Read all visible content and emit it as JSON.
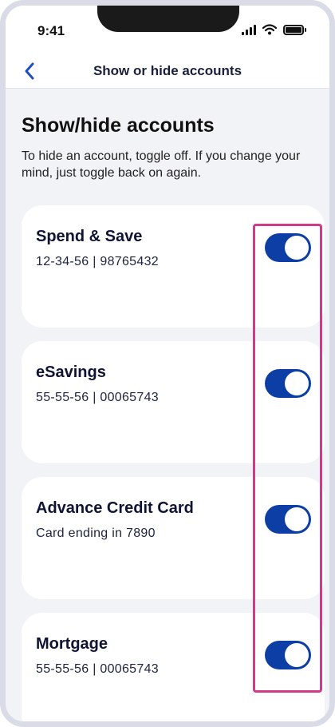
{
  "status_bar": {
    "time": "9:41"
  },
  "nav": {
    "title": "Show or hide accounts"
  },
  "page": {
    "heading": "Show/hide accounts",
    "description": "To hide an account, toggle off. If you change your mind, just toggle back on again."
  },
  "accounts": [
    {
      "name": "Spend & Save",
      "detail": "12-34-56 | 98765432",
      "visible": true
    },
    {
      "name": "eSavings",
      "detail": "55-55-56 | 00065743",
      "visible": true
    },
    {
      "name": "Advance Credit Card",
      "detail": "Card ending in 7890",
      "visible": true
    },
    {
      "name": "Mortgage",
      "detail": "55-55-56 | 00065743",
      "visible": true
    }
  ],
  "colors": {
    "accent": "#0d3ea6",
    "highlight": "#d13a86",
    "background": "#f2f3f7"
  },
  "icons": {
    "back": "chevron-left-icon",
    "signal": "cellular-signal-icon",
    "wifi": "wifi-icon",
    "battery": "battery-icon"
  }
}
